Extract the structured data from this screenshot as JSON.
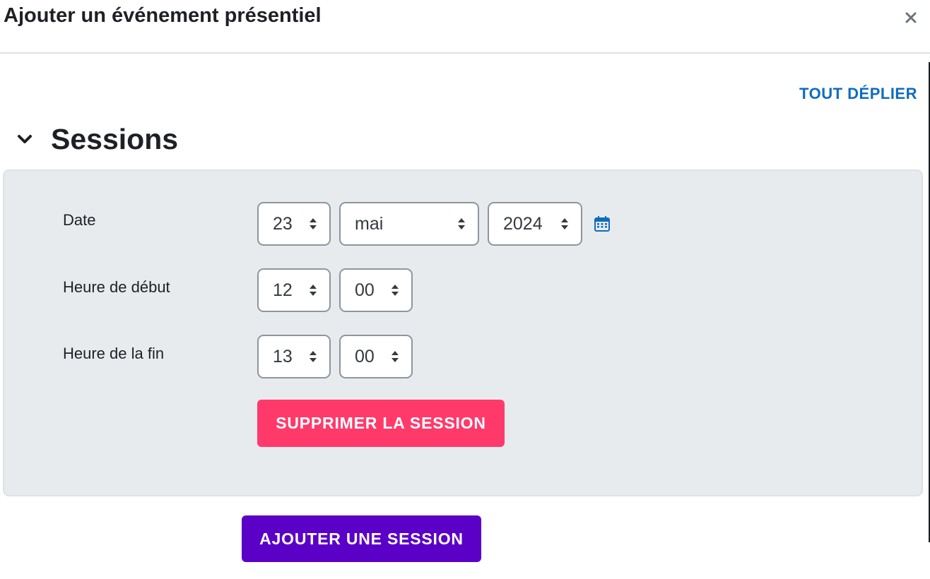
{
  "modal": {
    "title": "Ajouter un événement présentiel",
    "close_icon": "close-icon"
  },
  "expand_all_label": "Tout déplier",
  "section": {
    "title": "Sessions",
    "toggle_icon": "chevron-down-icon"
  },
  "session": {
    "date": {
      "label": "Date",
      "day": "23",
      "month": "mai",
      "year": "2024",
      "calendar_icon": "calendar-icon"
    },
    "start_time": {
      "label": "Heure de début",
      "hour": "12",
      "minute": "00"
    },
    "end_time": {
      "label": "Heure de la fin",
      "hour": "13",
      "minute": "00"
    },
    "delete_label": "Supprimer la session"
  },
  "add_session_label": "Ajouter une session",
  "colors": {
    "link": "#0f6cbf",
    "danger": "#ff3a6b",
    "primary": "#5b00c7",
    "panel_bg": "#e8ebee"
  }
}
